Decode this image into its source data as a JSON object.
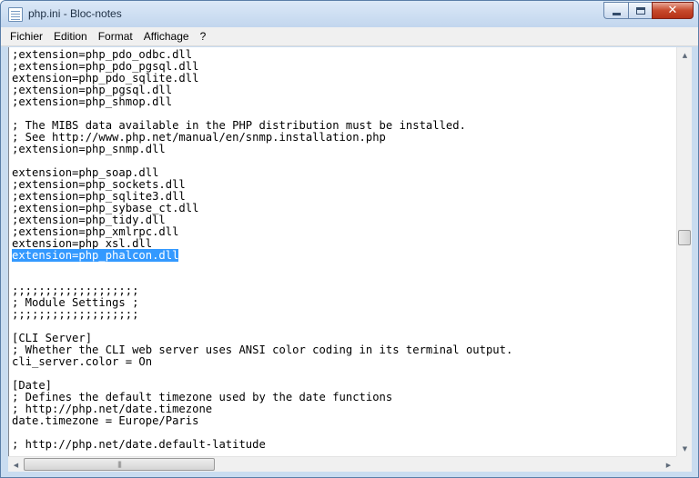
{
  "window": {
    "title": "php.ini - Bloc-notes",
    "close_glyph": "✕"
  },
  "menu": [
    "Fichier",
    "Edition",
    "Format",
    "Affichage",
    "?"
  ],
  "icons": {
    "app": "notepad-icon",
    "min": "minimize-icon",
    "max": "maximize-icon",
    "close": "close-icon",
    "scroll_up": "▲",
    "scroll_down": "▼",
    "scroll_left": "◀",
    "scroll_right": "▶",
    "grip": "|||"
  },
  "editor": {
    "lines": [
      ";extension=php_pdo_odbc.dll",
      ";extension=php_pdo_pgsql.dll",
      "extension=php_pdo_sqlite.dll",
      ";extension=php_pgsql.dll",
      ";extension=php_shmop.dll",
      "",
      "; The MIBS data available in the PHP distribution must be installed.",
      "; See http://www.php.net/manual/en/snmp.installation.php",
      ";extension=php_snmp.dll",
      "",
      "extension=php_soap.dll",
      ";extension=php_sockets.dll",
      ";extension=php_sqlite3.dll",
      ";extension=php_sybase_ct.dll",
      ";extension=php_tidy.dll",
      ";extension=php_xmlrpc.dll",
      "extension=php_xsl.dll",
      "extension=php_phalcon.dll",
      "",
      "",
      ";;;;;;;;;;;;;;;;;;;",
      "; Module Settings ;",
      ";;;;;;;;;;;;;;;;;;;",
      "",
      "[CLI Server]",
      "; Whether the CLI web server uses ANSI color coding in its terminal output.",
      "cli_server.color = On",
      "",
      "[Date]",
      "; Defines the default timezone used by the date functions",
      "; http://php.net/date.timezone",
      "date.timezone = Europe/Paris",
      "",
      "; http://php.net/date.default-latitude"
    ],
    "selected_line": 17
  }
}
